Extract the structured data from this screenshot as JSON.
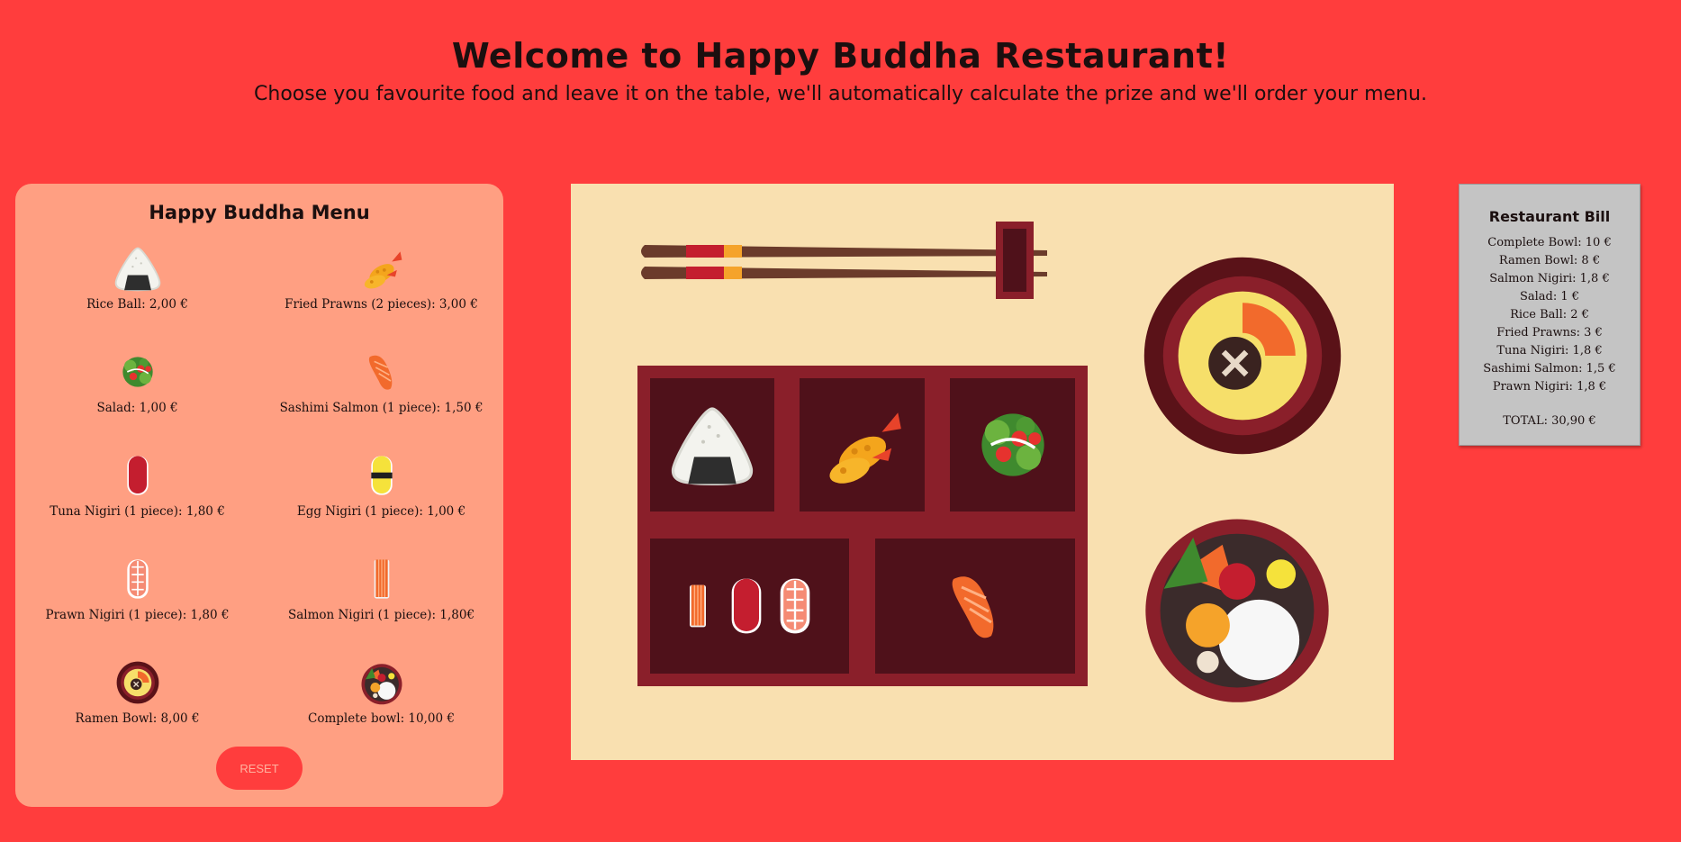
{
  "header": {
    "title": "Welcome to Happy Buddha Restaurant!",
    "subtitle": "Choose you favourite food and leave it on the table, we'll automatically calculate the prize and we'll order your menu."
  },
  "menu": {
    "title": "Happy Buddha Menu",
    "items": [
      {
        "label": "Rice Ball: 2,00 €",
        "icon": "rice-ball"
      },
      {
        "label": "Fried Prawns (2 pieces): 3,00 €",
        "icon": "fried-prawns"
      },
      {
        "label": "Salad: 1,00 €",
        "icon": "salad"
      },
      {
        "label": "Sashimi Salmon (1 piece): 1,50 €",
        "icon": "sashimi-salmon"
      },
      {
        "label": "Tuna Nigiri (1 piece): 1,80 €",
        "icon": "tuna-nigiri"
      },
      {
        "label": "Egg Nigiri (1 piece): 1,00 €",
        "icon": "egg-nigiri"
      },
      {
        "label": "Prawn Nigiri (1 piece): 1,80 €",
        "icon": "prawn-nigiri"
      },
      {
        "label": "Salmon Nigiri (1 piece): 1,80€",
        "icon": "salmon-nigiri"
      },
      {
        "label": "Ramen Bowl: 8,00 €",
        "icon": "ramen-bowl"
      },
      {
        "label": "Complete bowl: 10,00 €",
        "icon": "complete-bowl"
      }
    ],
    "reset_label": "RESET"
  },
  "table": {
    "items_on_table": [
      "chopsticks",
      "rice-ball",
      "fried-prawns",
      "salad",
      "salmon-nigiri",
      "tuna-nigiri",
      "prawn-nigiri",
      "sashimi-salmon",
      "ramen-bowl",
      "complete-bowl"
    ]
  },
  "bill": {
    "title": "Restaurant Bill",
    "lines": [
      "Complete Bowl: 10 €",
      "Ramen Bowl: 8 €",
      "Salmon Nigiri: 1,8 €",
      "Salad: 1 €",
      "Rice Ball: 2 €",
      "Fried Prawns: 3 €",
      "Tuna Nigiri: 1,8 €",
      "Sashimi Salmon: 1,5 €",
      "Prawn Nigiri: 1,8 €"
    ],
    "total": "TOTAL: 30,90 €"
  },
  "colors": {
    "background": "#ff3d3d",
    "menu_panel": "#ff9f82",
    "table": "#f9e0b0",
    "bento_frame": "#8a1f2a",
    "bento_cell": "#4f111a",
    "bill_panel": "#c4c4c4"
  }
}
